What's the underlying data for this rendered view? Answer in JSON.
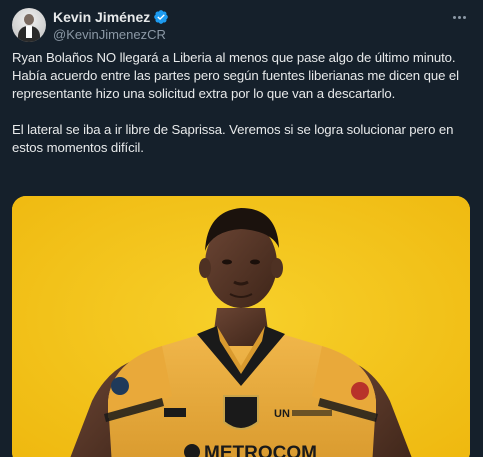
{
  "author": {
    "display_name": "Kevin Jiménez",
    "handle": "@KevinJimenezCR",
    "verified": true
  },
  "tweet": {
    "paragraphs": [
      "Ryan Bolaños NO llegará a Liberia al menos que pase algo de último minuto. Había acuerdo entre las partes pero según fuentes liberianas me dicen que el representante hizo una solicitud extra por lo que van a descartarlo.",
      "El lateral se iba a ir libre de Saprissa. Veremos si se logra solucionar pero en estos momentos difícil."
    ]
  },
  "media": {
    "background_color": "#f5c518",
    "sponsor_text": "METROCOM",
    "sponsor_secondary": "UN"
  },
  "icons": {
    "verified": "verified-badge-icon",
    "more": "more-options-icon"
  },
  "colors": {
    "background": "#15202b",
    "text_primary": "#e7e9ea",
    "text_secondary": "#8b98a5",
    "verified_blue": "#1d9bf0",
    "jersey_yellow": "#e8b13c"
  }
}
